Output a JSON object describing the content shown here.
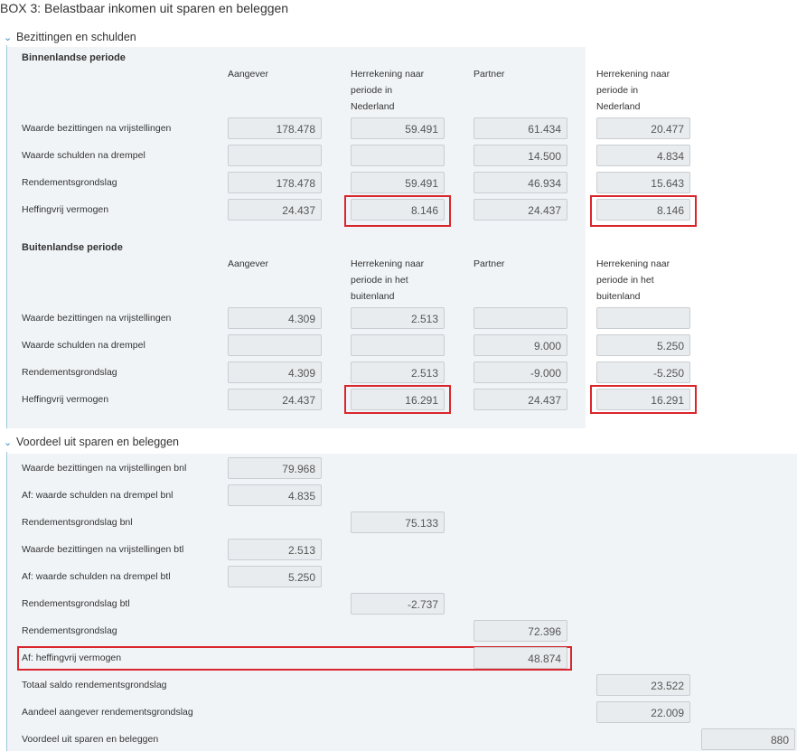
{
  "page_title": "BOX 3: Belastbaar inkomen uit sparen en beleggen",
  "sections": {
    "bezittingen": {
      "header": "Bezittingen en schulden",
      "binnenland": {
        "title": "Binnenlandse periode",
        "col_headers": [
          "Aangever",
          "Herrekening naar\nperiode in\nNederland",
          "Partner",
          "Herrekening naar\nperiode in\nNederland"
        ],
        "rows": [
          {
            "label": "Waarde bezittingen na vrijstellingen",
            "values": [
              "178.478",
              "59.491",
              "61.434",
              "20.477"
            ]
          },
          {
            "label": "Waarde schulden na drempel",
            "values": [
              "",
              "",
              "14.500",
              "4.834"
            ]
          },
          {
            "label": "Rendementsgrondslag",
            "values": [
              "178.478",
              "59.491",
              "46.934",
              "15.643"
            ]
          },
          {
            "label": "Heffingvrij vermogen",
            "values": [
              "24.437",
              "8.146",
              "24.437",
              "8.146"
            ]
          }
        ]
      },
      "buitenland": {
        "title": "Buitenlandse periode",
        "col_headers": [
          "Aangever",
          "Herrekening naar\nperiode in het\nbuitenland",
          "Partner",
          "Herrekening naar\nperiode in het\nbuitenland"
        ],
        "rows": [
          {
            "label": "Waarde bezittingen na vrijstellingen",
            "values": [
              "4.309",
              "2.513",
              "",
              ""
            ]
          },
          {
            "label": "Waarde schulden na drempel",
            "values": [
              "",
              "",
              "9.000",
              "5.250"
            ]
          },
          {
            "label": "Rendementsgrondslag",
            "values": [
              "4.309",
              "2.513",
              "-9.000",
              "-5.250"
            ]
          },
          {
            "label": "Heffingvrij vermogen",
            "values": [
              "24.437",
              "16.291",
              "24.437",
              "16.291"
            ]
          }
        ]
      }
    },
    "voordeel": {
      "header": "Voordeel uit sparen en beleggen",
      "rows": [
        {
          "label": "Waarde bezittingen na vrijstellingen bnl",
          "value": "79.968"
        },
        {
          "label": "Af: waarde schulden na drempel bnl",
          "value": "4.835"
        },
        {
          "label": "Rendementsgrondslag bnl",
          "value": "75.133"
        },
        {
          "label": "Waarde bezittingen na vrijstellingen btl",
          "value": "2.513"
        },
        {
          "label": "Af: waarde schulden na drempel btl",
          "value": "5.250"
        },
        {
          "label": "Rendementsgrondslag btl",
          "value": "-2.737"
        },
        {
          "label": "Rendementsgrondslag",
          "value": "72.396"
        },
        {
          "label": "Af: heffingvrij vermogen",
          "value": "48.874"
        },
        {
          "label": "Totaal saldo rendementsgrondslag",
          "value": "23.522"
        },
        {
          "label": "Aandeel aangever rendementsgrondslag",
          "value": "22.009"
        },
        {
          "label": "Voordeel uit sparen en beleggen",
          "value": "880"
        }
      ]
    }
  },
  "colors": {
    "highlight": "#d9262c",
    "chevron": "#3a8fc7",
    "panel": "#f1f4f7",
    "field": "#e9ecef"
  }
}
